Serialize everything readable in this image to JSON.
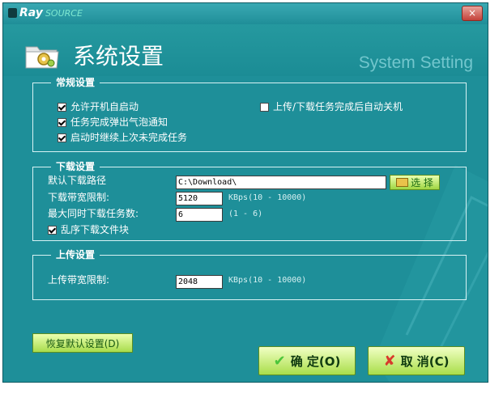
{
  "window": {
    "logo_primary": "Ray",
    "logo_secondary": "SOURCE",
    "close_label": "×"
  },
  "header": {
    "title": "系统设置",
    "subtitle": "System Setting"
  },
  "general": {
    "title": "常规设置",
    "auto_start": {
      "label": "允许开机自启动",
      "checked": true
    },
    "bubble_notify": {
      "label": "任务完成弹出气泡通知",
      "checked": true
    },
    "resume_tasks": {
      "label": "启动时继续上次未完成任务",
      "checked": true
    },
    "auto_shutdown": {
      "label": "上传/下载任务完成后自动关机",
      "checked": false
    }
  },
  "download": {
    "title": "下载设置",
    "path_label": "默认下载路径",
    "path_value": "C:\\Download\\",
    "choose_label": "选 择",
    "bandwidth_label": "下载带宽限制:",
    "bandwidth_value": "5120",
    "bandwidth_hint": "KBps(10 - 10000)",
    "max_tasks_label": "最大同时下载任务数:",
    "max_tasks_value": "6",
    "max_tasks_hint": "(1 - 6)",
    "random_blocks": {
      "label": "乱序下载文件块",
      "checked": true
    }
  },
  "upload": {
    "title": "上传设置",
    "bandwidth_label": "上传带宽限制:",
    "bandwidth_value": "2048",
    "bandwidth_hint": "KBps(10 - 10000)"
  },
  "footer": {
    "restore_label": "恢复默认设置(D)",
    "ok_label": "确 定(O)",
    "cancel_label": "取 消(C)"
  },
  "colors": {
    "background": "#1e8f99",
    "button_green": "#a9de4a",
    "accent_text": "#ffffff"
  }
}
